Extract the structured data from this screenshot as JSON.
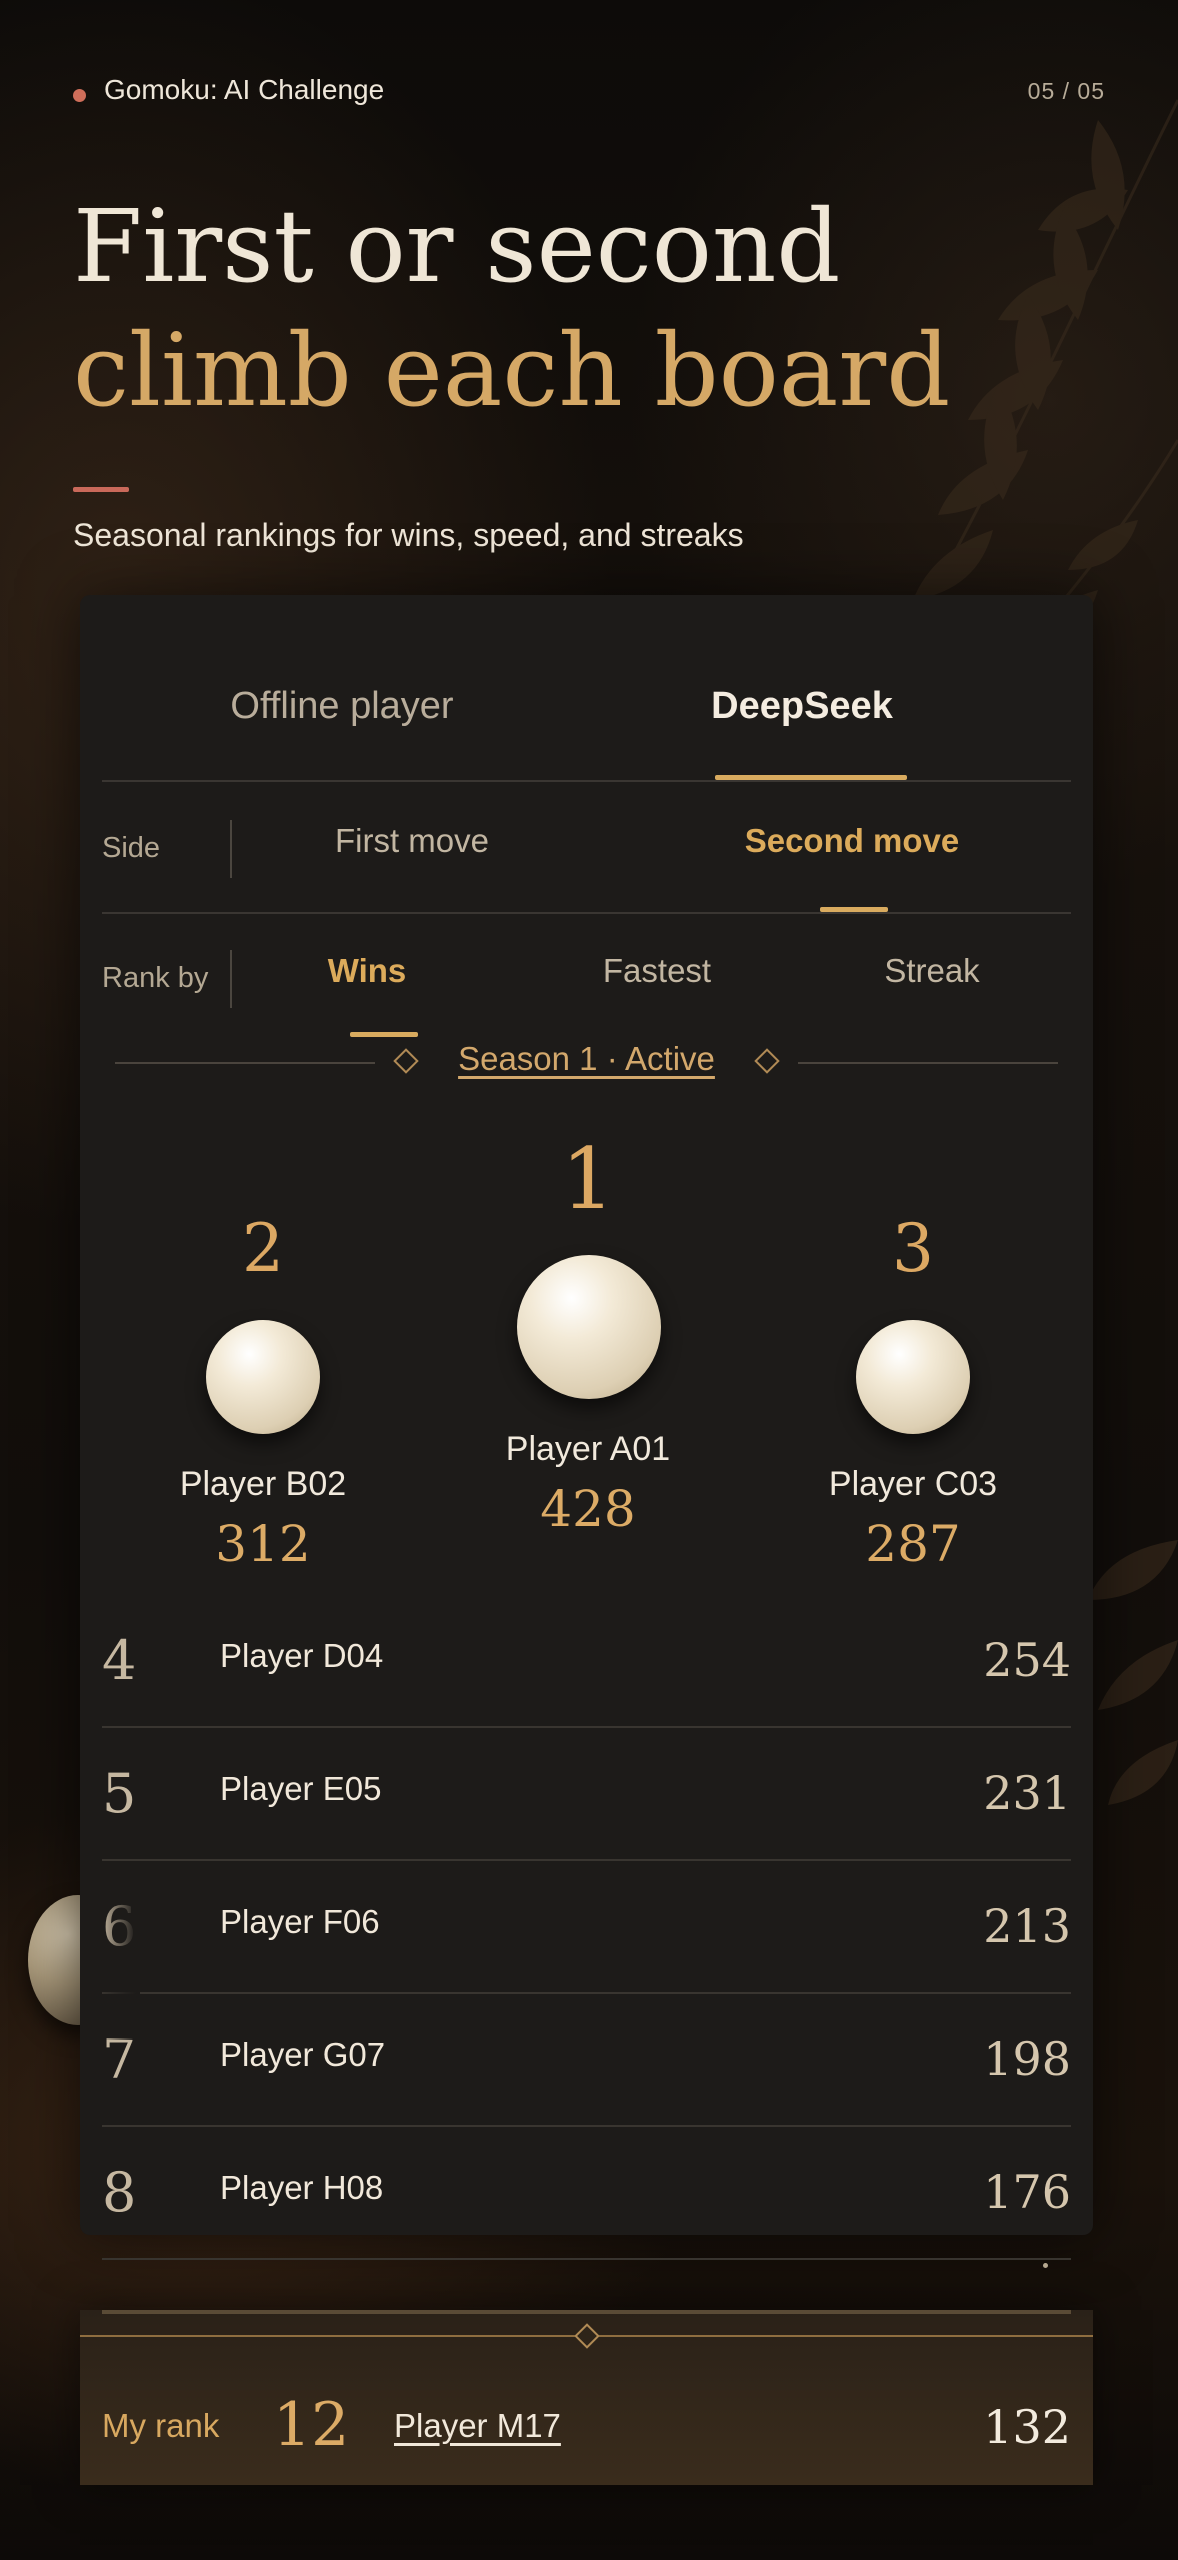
{
  "app": {
    "title": "Gomoku: AI Challenge",
    "page_indicator": "05 / 05"
  },
  "hero": {
    "line1": "First or second",
    "line2": "climb each board",
    "subtitle": "Seasonal rankings for wins, speed, and streaks"
  },
  "tabs": [
    {
      "label": "Offline player",
      "active": false
    },
    {
      "label": "DeepSeek",
      "active": true
    }
  ],
  "side_filter": {
    "label": "Side",
    "options": [
      {
        "label": "First move",
        "active": false
      },
      {
        "label": "Second move",
        "active": true
      }
    ]
  },
  "rank_filter": {
    "label": "Rank by",
    "options": [
      {
        "label": "Wins",
        "active": true
      },
      {
        "label": "Fastest",
        "active": false
      },
      {
        "label": "Streak",
        "active": false
      }
    ]
  },
  "season": {
    "label": "Season 1 · Active"
  },
  "podium": {
    "first": {
      "rank": "1",
      "name": "Player A01",
      "score": "428"
    },
    "second": {
      "rank": "2",
      "name": "Player B02",
      "score": "312"
    },
    "third": {
      "rank": "3",
      "name": "Player C03",
      "score": "287"
    }
  },
  "list": [
    {
      "rank": "4",
      "name": "Player D04",
      "score": "254"
    },
    {
      "rank": "5",
      "name": "Player E05",
      "score": "231"
    },
    {
      "rank": "6",
      "name": "Player F06",
      "score": "213"
    },
    {
      "rank": "7",
      "name": "Player G07",
      "score": "198"
    },
    {
      "rank": "8",
      "name": "Player H08",
      "score": "176"
    }
  ],
  "my_rank": {
    "label": "My rank",
    "rank": "12",
    "name": "Player M17",
    "score": "132"
  },
  "colors": {
    "accent_gold": "#d9ab5f",
    "accent_coral": "#cf6e5a",
    "panel": "#1d1b19"
  }
}
